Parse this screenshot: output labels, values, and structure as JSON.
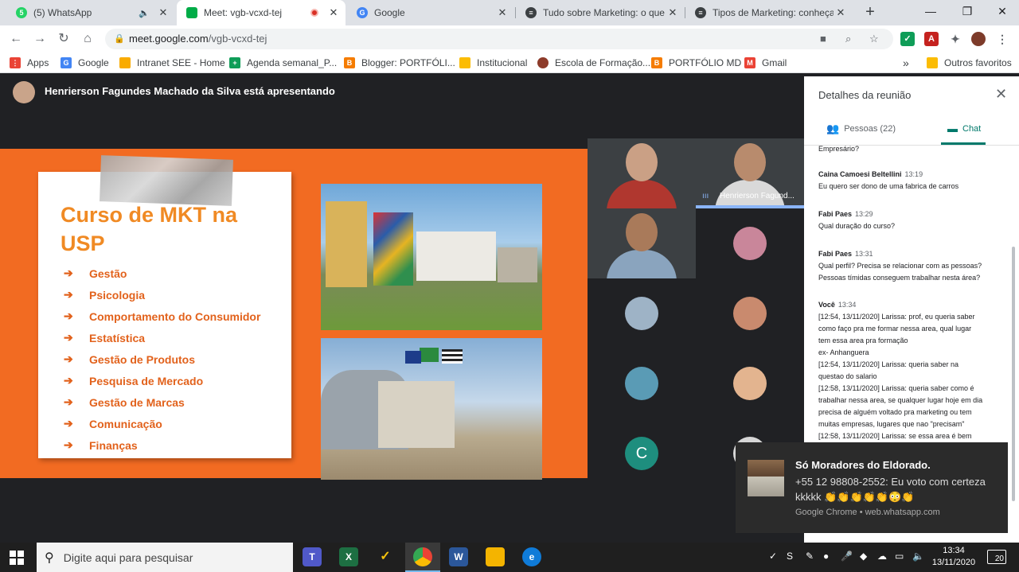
{
  "browser": {
    "tabs": [
      {
        "title": "(5) WhatsApp",
        "fav_color": "#25d366",
        "fav_glyph": "5"
      },
      {
        "title": "Meet: vgb-vcxd-tej",
        "fav_color": "#00ac47",
        "fav_glyph": ""
      },
      {
        "title": "Google",
        "fav_color": "#4285f4",
        "fav_glyph": "G"
      },
      {
        "title": "Tudo sobre Marketing: o que é",
        "fav_color": "#3c4043",
        "fav_glyph": "≡"
      },
      {
        "title": "Tipos de Marketing: conheça o",
        "fav_color": "#3c4043",
        "fav_glyph": "≡"
      }
    ],
    "url_host": "meet.google.com",
    "url_path": "/vgb-vcxd-tej",
    "bookmarks": [
      {
        "label": "Apps",
        "color": "#ea4335"
      },
      {
        "label": "Google",
        "color": "#4285f4"
      },
      {
        "label": "Intranet SEE - Home",
        "color": "#f9ab00"
      },
      {
        "label": "Agenda semanal_P...",
        "color": "#0f9d58"
      },
      {
        "label": "Blogger: PORTFÓLI...",
        "color": "#f57c00"
      },
      {
        "label": "Institucional",
        "color": "#fbbc04"
      },
      {
        "label": "Escola de Formação...",
        "color": "#8d3b2a"
      },
      {
        "label": "PORTFÓLIO MD",
        "color": "#f57c00"
      },
      {
        "label": "Gmail",
        "color": "#ea4335"
      },
      {
        "label": "»",
        "color": ""
      },
      {
        "label": "Outros favoritos",
        "color": "#fbbc04"
      }
    ]
  },
  "meet": {
    "presenter_text": "Henrierson Fagundes Machado da Silva está apresentando",
    "slide": {
      "title": "Curso de MKT na USP",
      "arrow": "➔",
      "topics": [
        "Gestão",
        "Psicologia",
        "Comportamento do Consumidor",
        "Estatística",
        "Gestão de Produtos",
        "Pesquisa de Mercado",
        "Gestão de Marcas",
        "Comunicação",
        "Finanças"
      ]
    },
    "speaking_name": "Henrierson Fagund...",
    "letter_avatar": "C"
  },
  "panel": {
    "title": "Detalhes da reunião",
    "people_label": "Pessoas (22)",
    "chat_label": "Chat",
    "messages": [
      {
        "who": "",
        "time": "",
        "lines": [
          "Empresário?"
        ]
      },
      {
        "who": "Caina Camoesi Beltellini",
        "time": "13:19",
        "lines": [
          "Eu quero ser dono de uma fabrica de carros"
        ]
      },
      {
        "who": "Fabi Paes",
        "time": "13:29",
        "lines": [
          "Qual duração do curso?"
        ]
      },
      {
        "who": "Fabi Paes",
        "time": "13:31",
        "lines": [
          "Qual perfil? Precisa se relacionar com as pessoas?",
          "Pessoas tímidas conseguem trabalhar nesta área?"
        ]
      },
      {
        "who": "Você",
        "time": "13:34",
        "lines": [
          "[12:54, 13/11/2020] Larissa: prof, eu queria saber",
          "como faço pra me formar nessa area, qual lugar",
          "tem essa area pra formação",
          "ex- Anhanguera",
          "[12:54, 13/11/2020] Larissa: queria saber na",
          "questao do salario",
          "[12:58, 13/11/2020] Larissa: queria saber como é",
          "trabalhar nessa area, se qualquer lugar hoje em dia",
          "precisa de alguém voltado pra marketing ou tem",
          "muitas empresas, lugares que nao \"precisam\"",
          "[12:58, 13/11/2020] Larissa: se essa area é bem"
        ]
      }
    ]
  },
  "notification": {
    "title": "Só Moradores do Eldorado.",
    "body": "+55 12 98808-2552: Eu voto com certeza kkkkk 👏👏👏👏👏😳👏",
    "footer": "Google Chrome • web.whatsapp.com"
  },
  "taskbar": {
    "search_placeholder": "Digite aqui para pesquisar",
    "time": "13:34",
    "date": "13/11/2020",
    "notif_count": "20"
  }
}
